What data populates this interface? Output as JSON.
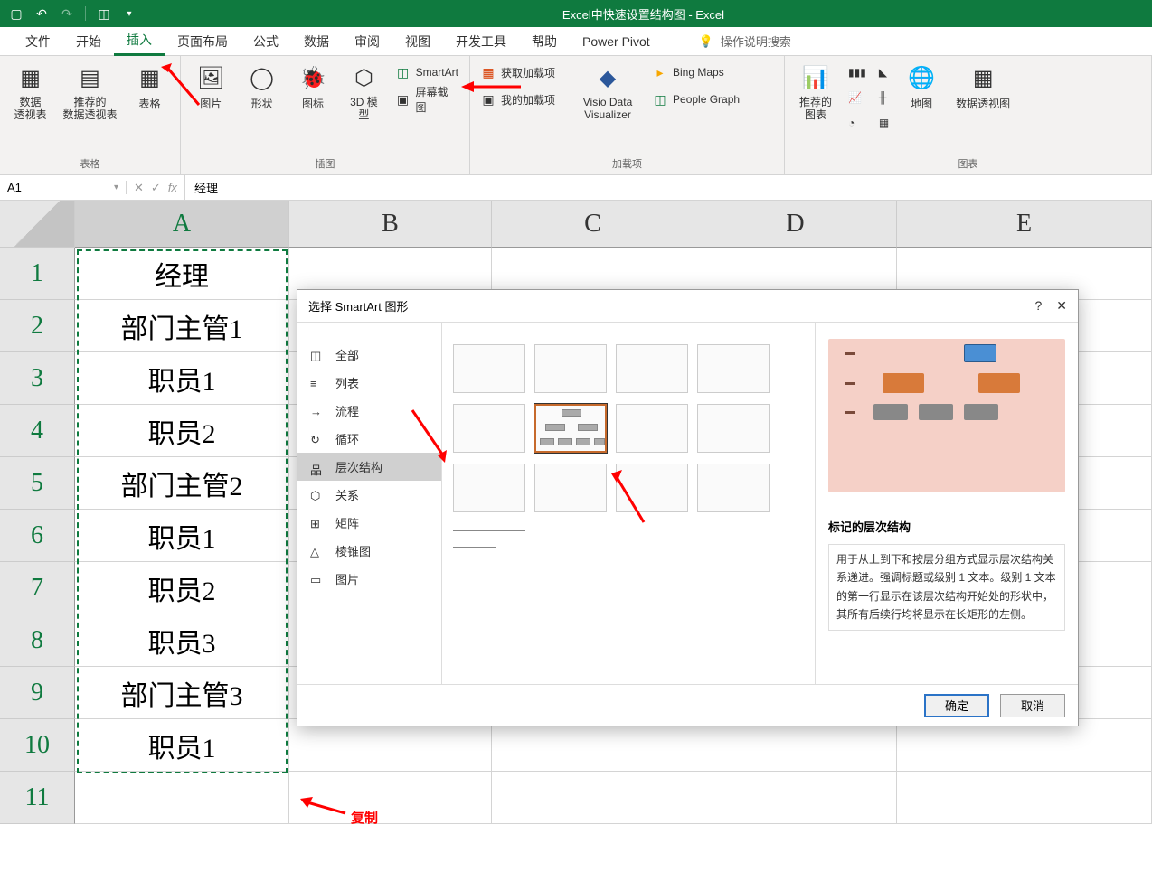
{
  "window": {
    "title": "Excel中快速设置结构图  -  Excel"
  },
  "qat": {
    "save": "💾",
    "undo": "↶",
    "redo": "↷",
    "touch": "🔍"
  },
  "tabs": {
    "file": "文件",
    "home": "开始",
    "insert": "插入",
    "layout": "页面布局",
    "formulas": "公式",
    "data": "数据",
    "review": "审阅",
    "view": "视图",
    "dev": "开发工具",
    "help": "帮助",
    "pp": "Power Pivot",
    "search_hint": "操作说明搜索"
  },
  "ribbon": {
    "g_tables": "表格",
    "pivot": "数据\n透视表",
    "rec_pivot": "推荐的\n数据透视表",
    "table": "表格",
    "g_illus": "插图",
    "pic": "图片",
    "shapes": "形状",
    "icons": "图标",
    "model3d": "3D 模\n型",
    "smartart": "SmartArt",
    "screenshot": "屏幕截图",
    "g_addins": "加载项",
    "get_addins": "获取加载项",
    "my_addins": "我的加载项",
    "visio": "Visio Data\nVisualizer",
    "bing": "Bing Maps",
    "people": "People Graph",
    "g_charts": "图表",
    "rec_chart": "推荐的\n图表",
    "maps": "地图",
    "pivot_chart": "数据透视图"
  },
  "formula_bar": {
    "cell_ref": "A1",
    "value": "经理"
  },
  "columns": [
    "A",
    "B",
    "C",
    "D",
    "E"
  ],
  "cells": {
    "A1": "经理",
    "A2": "部门主管1",
    "A3": "职员1",
    "A4": "职员2",
    "A5": "部门主管2",
    "A6": "职员1",
    "A7": "职员2",
    "A8": "职员3",
    "A9": "部门主管3",
    "A10": "职员1"
  },
  "dialog": {
    "title": "选择 SmartArt 图形",
    "help": "?",
    "close": "✕",
    "cats": {
      "all": "全部",
      "list": "列表",
      "process": "流程",
      "cycle": "循环",
      "hierarchy": "层次结构",
      "relationship": "关系",
      "matrix": "矩阵",
      "pyramid": "棱锥图",
      "picture": "图片"
    },
    "preview_title": "标记的层次结构",
    "preview_desc": "用于从上到下和按层分组方式显示层次结构关系递进。强调标题或级别 1 文本。级别 1 文本的第一行显示在该层次结构开始处的形状中，其所有后续行均将显示在长矩形的左侧。",
    "ok": "确定",
    "cancel": "取消"
  },
  "annotations": {
    "copy": "复制"
  }
}
